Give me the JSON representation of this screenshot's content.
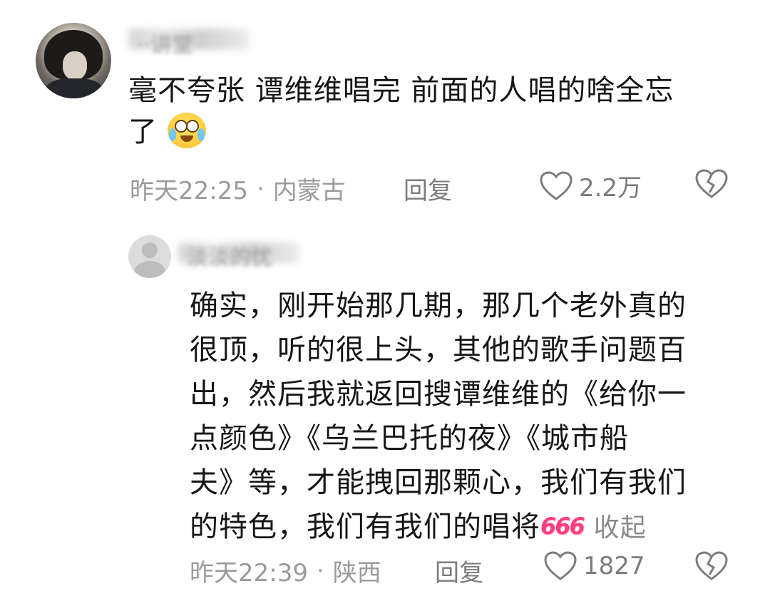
{
  "comment": {
    "username": "··讲堂",
    "text_line1": "毫不夸张 谭维维唱完 前面的人唱的啥全忘",
    "text_line2": "了",
    "emoji_icon": "crying-laughing-emoji",
    "time": "昨天22:25",
    "dot": "·",
    "location": "内蒙古",
    "reply_label": "回复",
    "like_count": "2.2万"
  },
  "reply": {
    "username": "淡淡的忧",
    "lines": [
      "确实，刚开始那几期，那几个老外真的",
      "很顶，听的很上头，其他的歌手问题百",
      "出，然后我就返回搜谭维维的《给你一",
      "点颜色》《乌兰巴托的夜》《城市船",
      "夫》等，才能拽回那颗心，我们有我们"
    ],
    "last_line": "的特色，我们有我们的唱将",
    "sticker_text": "666",
    "collapse_label": "收起",
    "time": "昨天22:39",
    "dot": "·",
    "location": "陕西",
    "reply_label": "回复",
    "like_count": "1827"
  },
  "colors": {
    "text_primary": "#161616",
    "text_meta": "#9b9b9b",
    "icon_gray": "#7c7c7c"
  }
}
